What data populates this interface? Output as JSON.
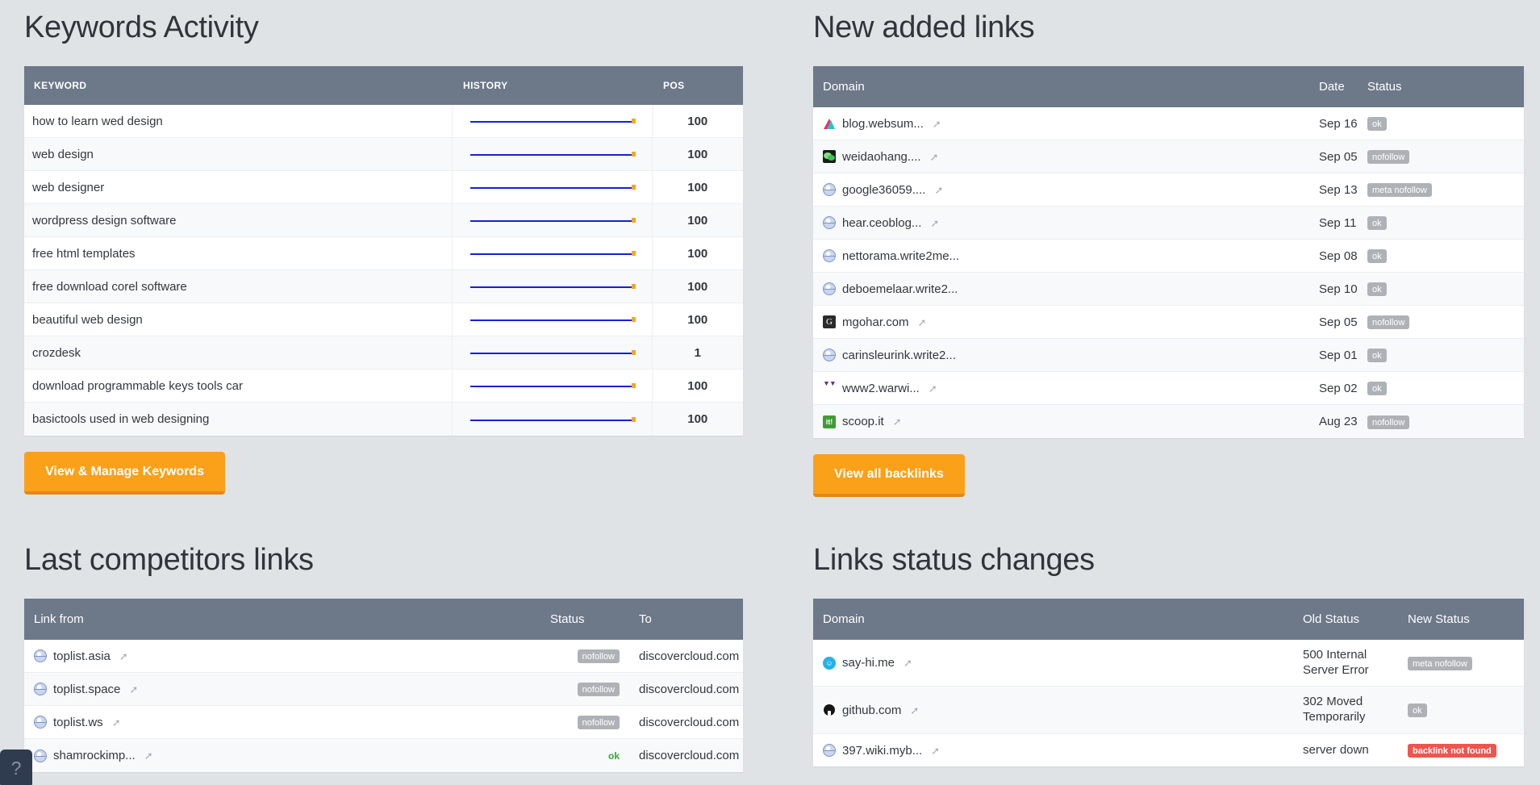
{
  "keywords_panel": {
    "title": "Keywords Activity",
    "columns": [
      "KEYWORD",
      "HISTORY",
      "POS"
    ],
    "rows": [
      {
        "keyword": "how to learn wed design",
        "pos": "100"
      },
      {
        "keyword": "web design",
        "pos": "100"
      },
      {
        "keyword": "web designer",
        "pos": "100"
      },
      {
        "keyword": "wordpress design software",
        "pos": "100"
      },
      {
        "keyword": "free html templates",
        "pos": "100"
      },
      {
        "keyword": "free download corel software",
        "pos": "100"
      },
      {
        "keyword": "beautiful web design",
        "pos": "100"
      },
      {
        "keyword": "crozdesk",
        "pos": "1"
      },
      {
        "keyword": "download programmable keys tools car",
        "pos": "100"
      },
      {
        "keyword": "basictools used in web designing",
        "pos": "100"
      }
    ],
    "button_label": "View & Manage Keywords"
  },
  "new_links_panel": {
    "title": "New added links",
    "columns": [
      "Domain",
      "Date",
      "Status"
    ],
    "rows": [
      {
        "domain": "blog.websum...",
        "icon": "favicon-triangle",
        "date": "Sep 16",
        "status": "ok"
      },
      {
        "domain": "weidaohang....",
        "icon": "favicon-wechat",
        "date": "Sep 05",
        "status": "nofollow"
      },
      {
        "domain": "google36059....",
        "icon": "favicon-globe",
        "date": "Sep 13",
        "status": "meta nofollow"
      },
      {
        "domain": "hear.ceoblog...",
        "icon": "favicon-globe",
        "date": "Sep 11",
        "status": "ok"
      },
      {
        "domain": "nettorama.write2me...",
        "icon": "favicon-globe",
        "date": "Sep 08",
        "status": "ok",
        "no_arrow": true
      },
      {
        "domain": "deboemelaar.write2...",
        "icon": "favicon-globe",
        "date": "Sep 10",
        "status": "ok",
        "no_arrow": true
      },
      {
        "domain": "mgohar.com",
        "icon": "favicon-mgohar",
        "date": "Sep 05",
        "status": "nofollow"
      },
      {
        "domain": "carinsleurink.write2...",
        "icon": "favicon-globe",
        "date": "Sep 01",
        "status": "ok",
        "no_arrow": true
      },
      {
        "domain": "www2.warwi...",
        "icon": "favicon-warwick",
        "date": "Sep 02",
        "status": "ok"
      },
      {
        "domain": "scoop.it",
        "icon": "favicon-scoopit",
        "date": "Aug 23",
        "status": "nofollow"
      }
    ],
    "button_label": "View all backlinks"
  },
  "competitors_panel": {
    "title": "Last competitors links",
    "columns": [
      "Link from",
      "Status",
      "To"
    ],
    "rows": [
      {
        "link_from": "toplist.asia",
        "icon": "favicon-globe",
        "status": "nofollow",
        "status_type": "badge",
        "to": "discovercloud.com"
      },
      {
        "link_from": "toplist.space",
        "icon": "favicon-globe",
        "status": "nofollow",
        "status_type": "badge",
        "to": "discovercloud.com"
      },
      {
        "link_from": "toplist.ws",
        "icon": "favicon-globe",
        "status": "nofollow",
        "status_type": "badge",
        "to": "discovercloud.com"
      },
      {
        "link_from": "shamrockimp...",
        "icon": "favicon-globe",
        "status": "ok",
        "status_type": "text-green",
        "to": "discovercloud.com"
      }
    ]
  },
  "status_changes_panel": {
    "title": "Links status changes",
    "columns": [
      "Domain",
      "Old Status",
      "New Status"
    ],
    "rows": [
      {
        "domain": "say-hi.me",
        "icon": "favicon-sayhi",
        "old_status": "500 Internal Server Error",
        "new_status": "meta nofollow",
        "new_status_type": "badge"
      },
      {
        "domain": "github.com",
        "icon": "favicon-github",
        "old_status": "302 Moved Temporarily",
        "new_status": "ok",
        "new_status_type": "badge"
      },
      {
        "domain": "397.wiki.myb...",
        "icon": "favicon-globe",
        "old_status": "server down",
        "new_status": "backlink not found",
        "new_status_type": "badge-red"
      }
    ]
  },
  "help_widget": {
    "label": "?"
  },
  "colors": {
    "page_background": "#dfe3e6",
    "table_header": "#6d7889",
    "accent_orange": "#fba019",
    "badge_gray": "#aeb2b7",
    "badge_red": "#f0554d",
    "sparkline_line": "#1421d6",
    "sparkline_marker": "#f5a623"
  }
}
